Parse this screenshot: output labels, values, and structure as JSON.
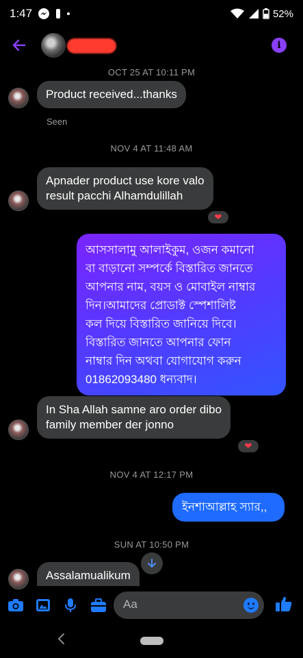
{
  "status_bar": {
    "time": "1:47",
    "battery": "52%"
  },
  "thread": {
    "timestamps": [
      "OCT 25 AT 10:11 PM",
      "NOV 4 AT 11:48 AM",
      "NOV 4 AT 12:17 PM",
      "SUN AT 10:50 PM"
    ],
    "seen_label": "Seen",
    "messages": [
      {
        "lines": [
          "Product received...thanks"
        ]
      },
      {
        "lines": [
          "Apnader product use kore valo",
          "result pacchi Alhamdulillah"
        ],
        "reaction": "heart"
      },
      {
        "lines": [
          "আসসালামু আলাইকুম, ওজন কমানো",
          "বা বাড়ানো সম্পর্কে বিস্তারিত জানতে",
          "আপনার নাম, বয়স ও মোবাইল নাম্বার",
          "দিন।আমাদের প্রোডাক্ট স্পেশালিষ্ট",
          "কল দিয়ে বিস্তারিত জানিয়ে দিবে।",
          "বিস্তারিত জানতে  আপনার ফোন",
          "নাম্বার দিন অথবা যোগাযোগ  করুন",
          "01862093480 ধন্যবাদ।"
        ]
      },
      {
        "lines": [
          "In Sha Allah samne aro order dibo",
          "family member der jonno"
        ],
        "reaction": "heart"
      },
      {
        "lines": [
          "ইনশাআল্লাহ স্যার,,"
        ]
      },
      {
        "lines": [
          "Assalamualikum"
        ]
      }
    ]
  },
  "composer": {
    "placeholder": "Aa"
  },
  "icons": {
    "back": "back-arrow-icon",
    "info": "info-icon",
    "camera": "camera-icon",
    "gallery": "image-icon",
    "mic": "microphone-icon",
    "more": "briefcase-icon",
    "emoji": "emoji-icon",
    "like": "thumbs-up-icon"
  },
  "colors": {
    "accent": "#8a3ffc",
    "outgoing_blue": "#1f6bff",
    "incoming": "#3a3b3c",
    "reaction": "#ff3b4a"
  }
}
